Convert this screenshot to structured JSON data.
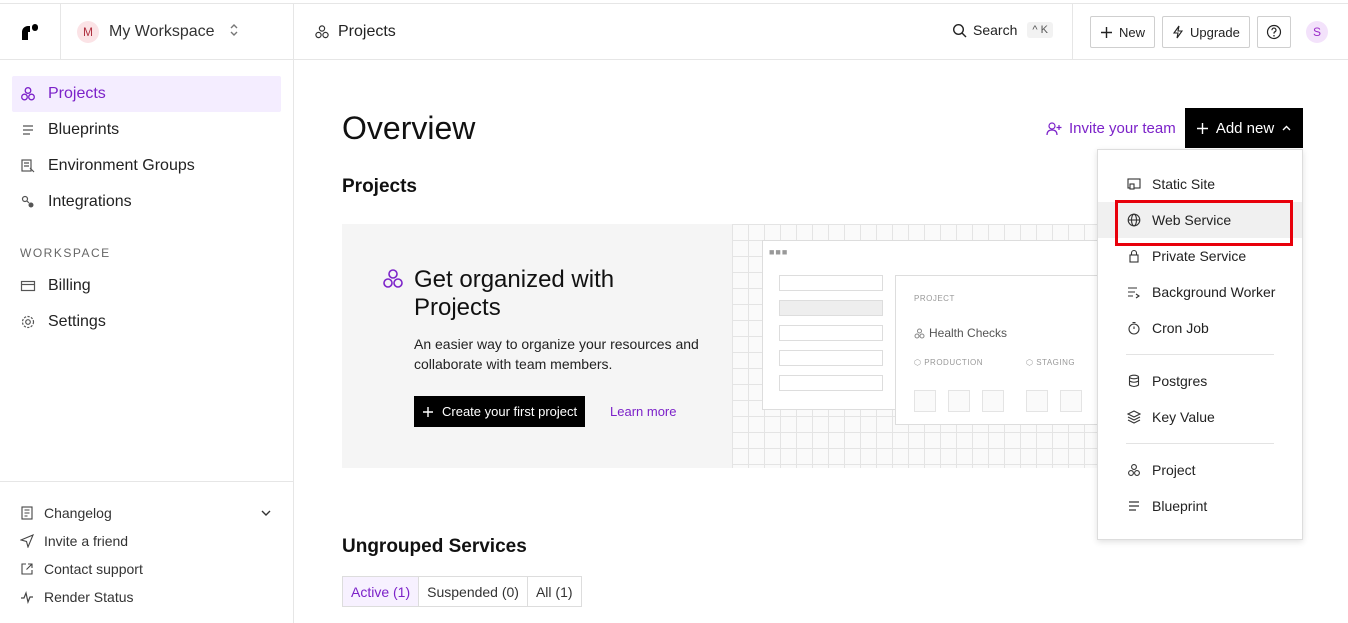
{
  "workspace": {
    "initial": "M",
    "name": "My Workspace"
  },
  "sidebar": {
    "items": [
      {
        "label": "Projects",
        "icon": "projects-icon",
        "active": true
      },
      {
        "label": "Blueprints",
        "icon": "blueprint-icon"
      },
      {
        "label": "Environment Groups",
        "icon": "environment-icon"
      },
      {
        "label": "Integrations",
        "icon": "integrations-icon"
      }
    ],
    "workspace_label": "WORKSPACE",
    "workspace_items": [
      {
        "label": "Billing",
        "icon": "billing-icon"
      },
      {
        "label": "Settings",
        "icon": "gear-icon"
      }
    ],
    "footer": [
      {
        "label": "Changelog",
        "icon": "changelog-icon"
      },
      {
        "label": "Invite a friend",
        "icon": "send-icon"
      },
      {
        "label": "Contact support",
        "icon": "external-link-icon"
      },
      {
        "label": "Render Status",
        "icon": "activity-icon"
      }
    ]
  },
  "header": {
    "breadcrumb": "Projects",
    "search_label": "Search",
    "search_shortcut": "^ K",
    "new_label": "New",
    "upgrade_label": "Upgrade",
    "user_initial": "S"
  },
  "main": {
    "title": "Overview",
    "invite_label": "Invite your team",
    "add_new_label": "Add new",
    "projects_heading": "Projects",
    "promo": {
      "title": "Get organized with Projects",
      "description": "An easier way to organize your resources and collaborate with team members.",
      "create_label": "Create your first project",
      "learn_more": "Learn more",
      "illustration": {
        "project_label": "PROJECT",
        "project_name": "Health Checks",
        "env1": "PRODUCTION",
        "env2": "STAGING"
      }
    },
    "ungrouped_heading": "Ungrouped Services",
    "filters": [
      "Active (1)",
      "Suspended (0)",
      "All (1)"
    ]
  },
  "dropdown": {
    "group1": [
      "Static Site",
      "Web Service",
      "Private Service",
      "Background Worker",
      "Cron Job"
    ],
    "group2": [
      "Postgres",
      "Key Value"
    ],
    "group3": [
      "Project",
      "Blueprint"
    ],
    "highlighted": "Web Service"
  },
  "colors": {
    "accent": "#7c22c9",
    "highlight_border": "#e8000b"
  }
}
